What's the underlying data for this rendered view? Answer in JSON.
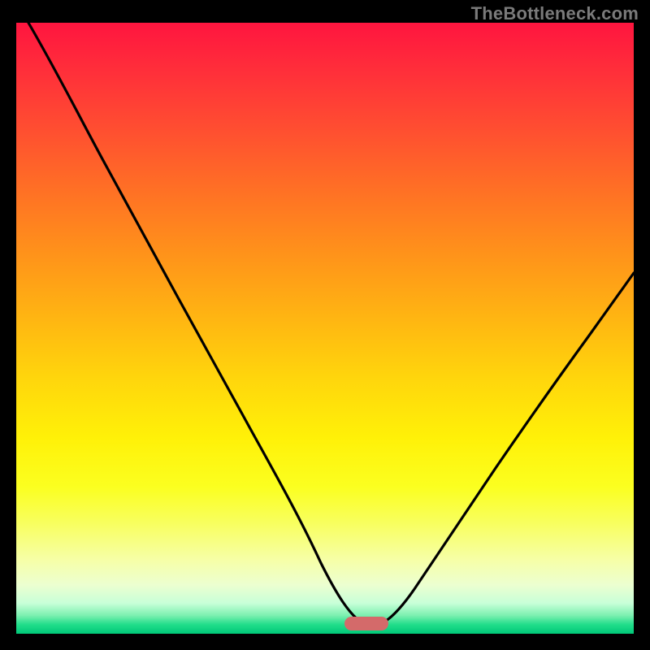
{
  "watermark": "TheBottleneck.com",
  "colors": {
    "frame_bg": "#000000",
    "curve": "#000000",
    "marker_fill": "#d46a6a",
    "marker_stroke": "#c05858"
  },
  "chart_data": {
    "type": "line",
    "title": "",
    "xlabel": "",
    "ylabel": "",
    "xlim": [
      0,
      100
    ],
    "ylim": [
      0,
      100
    ],
    "grid": false,
    "legend": false,
    "notes": "Unlabeled bottleneck-style curve on a red→green vertical gradient background. Y values estimated from pixel positions (0 at bottom, 100 at top). Minimum of the curve occurs around x≈56–58.",
    "series": [
      {
        "name": "bottleneck-curve",
        "x": [
          2,
          8,
          14,
          20,
          26,
          32,
          38,
          44,
          50,
          54,
          56,
          58,
          60,
          64,
          70,
          76,
          82,
          88,
          94,
          100
        ],
        "values": [
          100,
          91,
          82,
          73,
          65,
          56,
          47,
          37,
          22,
          10,
          3,
          2,
          3,
          8,
          16,
          24,
          32,
          40,
          48,
          56
        ]
      }
    ],
    "marker": {
      "shape": "rounded-rect",
      "x_center": 57,
      "y_center": 1.5,
      "width_x_units": 7,
      "height_y_units": 2.2
    }
  }
}
